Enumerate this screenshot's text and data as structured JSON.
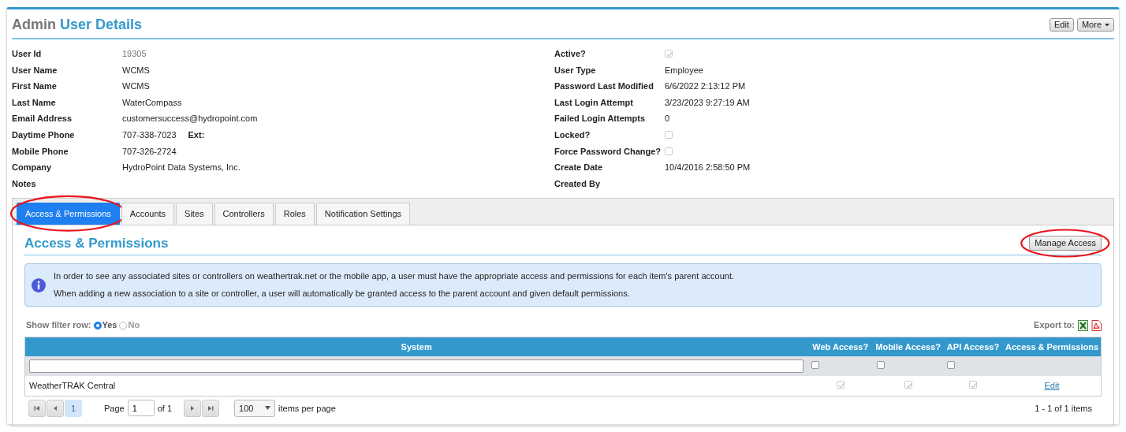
{
  "header": {
    "prefix": "Admin",
    "title": "User Details",
    "buttons": [
      {
        "label": "Edit",
        "kind": "plain"
      },
      {
        "label": "More",
        "kind": "dropdown"
      }
    ]
  },
  "fields_left": [
    {
      "label": "User Id",
      "value": "19305",
      "kind": "muted"
    },
    {
      "label": "User Name",
      "value": "WCMS",
      "kind": "text"
    },
    {
      "label": "First Name",
      "value": "WCMS",
      "kind": "text"
    },
    {
      "label": "Last Name",
      "value": "WaterCompass",
      "kind": "text"
    },
    {
      "label": "Email Address",
      "value": "customersuccess@hydropoint.com",
      "kind": "text"
    },
    {
      "label": "Daytime Phone",
      "value": "707-338-7023",
      "ext_label": "Ext:",
      "kind": "text"
    },
    {
      "label": "Mobile Phone",
      "value": "707-326-2724",
      "kind": "text"
    },
    {
      "label": "Company",
      "value": "HydroPoint Data Systems, Inc.",
      "kind": "text"
    },
    {
      "label": "Notes",
      "kind": "empty"
    }
  ],
  "fields_right": [
    {
      "label": "Active?",
      "kind": "checkbox",
      "checked": true
    },
    {
      "label": "User Type",
      "value": "Employee",
      "kind": "text"
    },
    {
      "label": "Password Last Modified",
      "value": "6/6/2022 2:13:12 PM",
      "kind": "text"
    },
    {
      "label": "Last Login Attempt",
      "value": "3/23/2023 9:27:19 AM",
      "kind": "text"
    },
    {
      "label": "Failed Login Attempts",
      "value": "0",
      "kind": "text"
    },
    {
      "label": "Locked?",
      "kind": "checkbox",
      "checked": false
    },
    {
      "label": "Force Password Change?",
      "kind": "checkbox",
      "checked": false
    },
    {
      "label": "Create Date",
      "value": "10/4/2016 2:58:50 PM",
      "kind": "text"
    },
    {
      "label": "Created By",
      "kind": "empty"
    }
  ],
  "tabs": [
    {
      "label": "Access & Permissions",
      "selected": true,
      "circled": true
    },
    {
      "label": "Accounts",
      "selected": false,
      "circled": false
    },
    {
      "label": "Sites",
      "selected": false,
      "circled": false
    },
    {
      "label": "Controllers",
      "selected": false,
      "circled": false
    },
    {
      "label": "Roles",
      "selected": false,
      "circled": false
    },
    {
      "label": "Notification Settings",
      "selected": false,
      "circled": false
    }
  ],
  "section": {
    "title": "Access & Permissions",
    "manage_button": {
      "label": "Manage Access",
      "circled": true
    }
  },
  "info": [
    "In order to see any associated sites or controllers on weathertrak.net or the mobile app, a user must have the appropriate access and permissions for each item's parent account.",
    "When adding a new association to a site or controller, a user will automatically be granted access to the parent account and given default permissions."
  ],
  "filter_toggle": {
    "label": "Show filter row:",
    "options": [
      {
        "label": "Yes",
        "selected": true
      },
      {
        "label": "No",
        "selected": false
      }
    ]
  },
  "export": {
    "label": "Export to:"
  },
  "table": {
    "columns": [
      "System",
      "Web Access?",
      "Mobile Access?",
      "API Access?",
      "Access & Permissions"
    ],
    "filter_row": {
      "web_access": false,
      "mobile_access": false,
      "api_access": false
    },
    "rows": [
      {
        "system": "WeatherTRAK Central",
        "web_access": true,
        "mobile_access": true,
        "api_access": true,
        "action": "Edit"
      }
    ]
  },
  "pager": {
    "current": "1",
    "page_label": "Page",
    "page_value": "1",
    "of_label": "of 1",
    "page_size": "100",
    "per_page_label": "items per page",
    "summary": "1 - 1 of 1 items"
  }
}
